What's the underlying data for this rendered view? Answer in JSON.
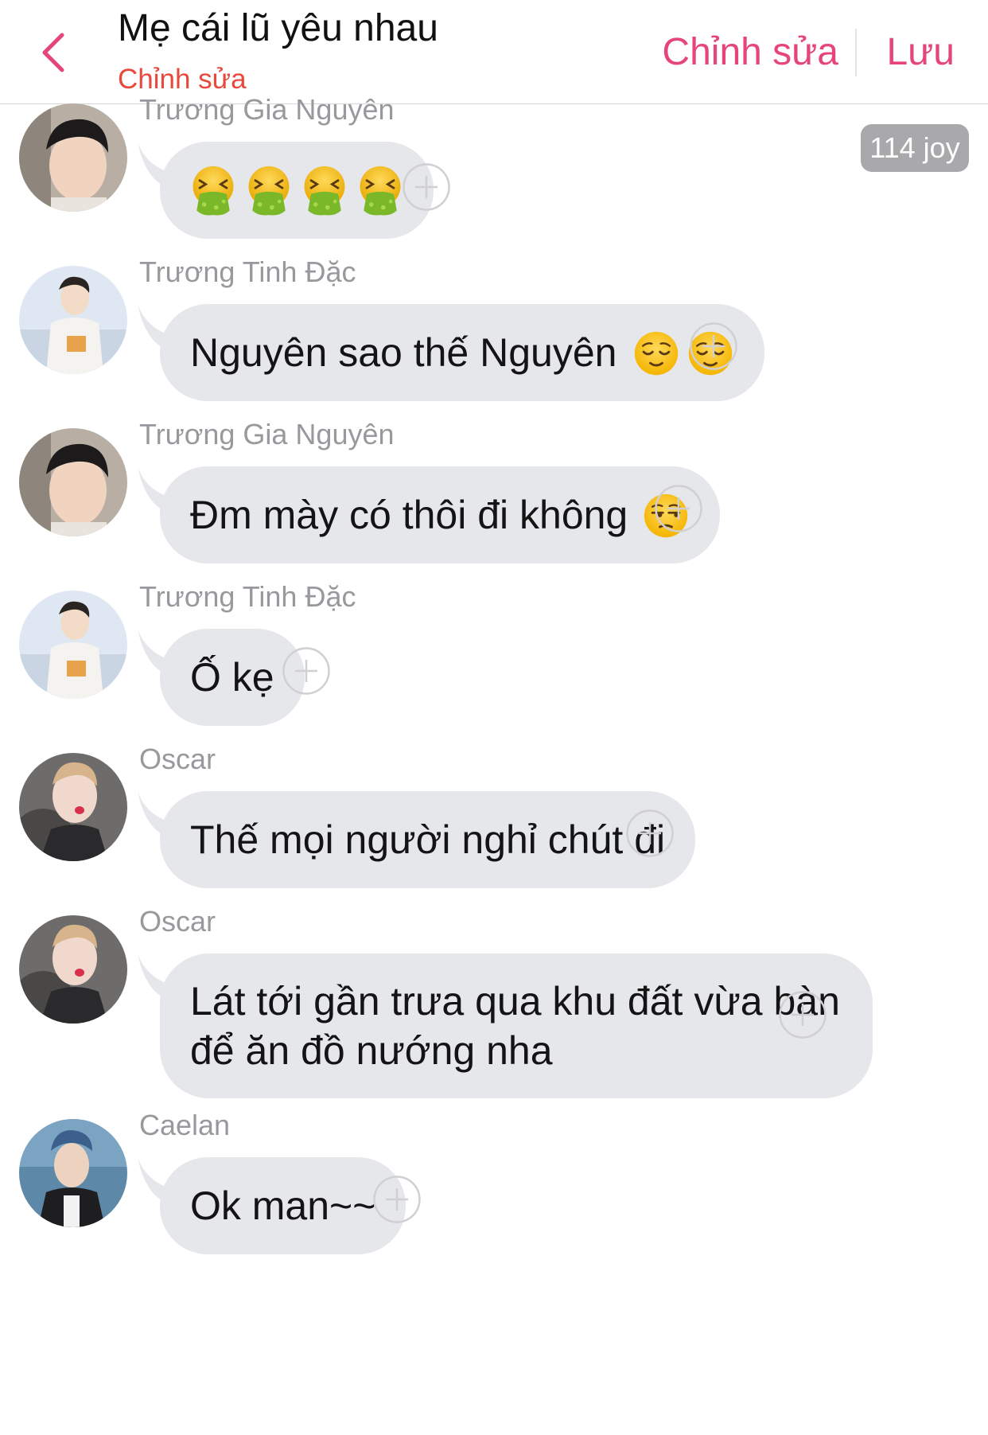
{
  "header": {
    "title": "Mẹ cái lũ yêu nhau",
    "subtitle": "Chỉnh sửa",
    "edit_label": "Chỉnh sửa",
    "save_label": "Lưu",
    "accent_color": "#e6457a"
  },
  "badge": {
    "text": "114 joy"
  },
  "messages": [
    {
      "sender": "Trương Gia Nguyên",
      "text": "",
      "emojis": [
        "nauseated-face",
        "nauseated-face",
        "nauseated-face",
        "nauseated-face"
      ]
    },
    {
      "sender": "Trương Tinh Đặc",
      "text": "Nguyên sao thế Nguyên",
      "emojis": [
        "relieved-face",
        "relieved-face"
      ]
    },
    {
      "sender": "Trương Gia Nguyên",
      "text": "Đm mày có thôi đi không",
      "emojis": [
        "unamused-face"
      ]
    },
    {
      "sender": "Trương Tinh Đặc",
      "text": "Ố kẹ",
      "emojis": []
    },
    {
      "sender": "Oscar",
      "text": "Thế mọi người nghỉ chút đi",
      "emojis": []
    },
    {
      "sender": "Oscar",
      "text": "Lát tới gần trưa qua khu đất vừa bàn để ăn đồ nướng nha",
      "emojis": []
    },
    {
      "sender": "Caelan",
      "text": "Ok man~~",
      "emojis": []
    }
  ]
}
